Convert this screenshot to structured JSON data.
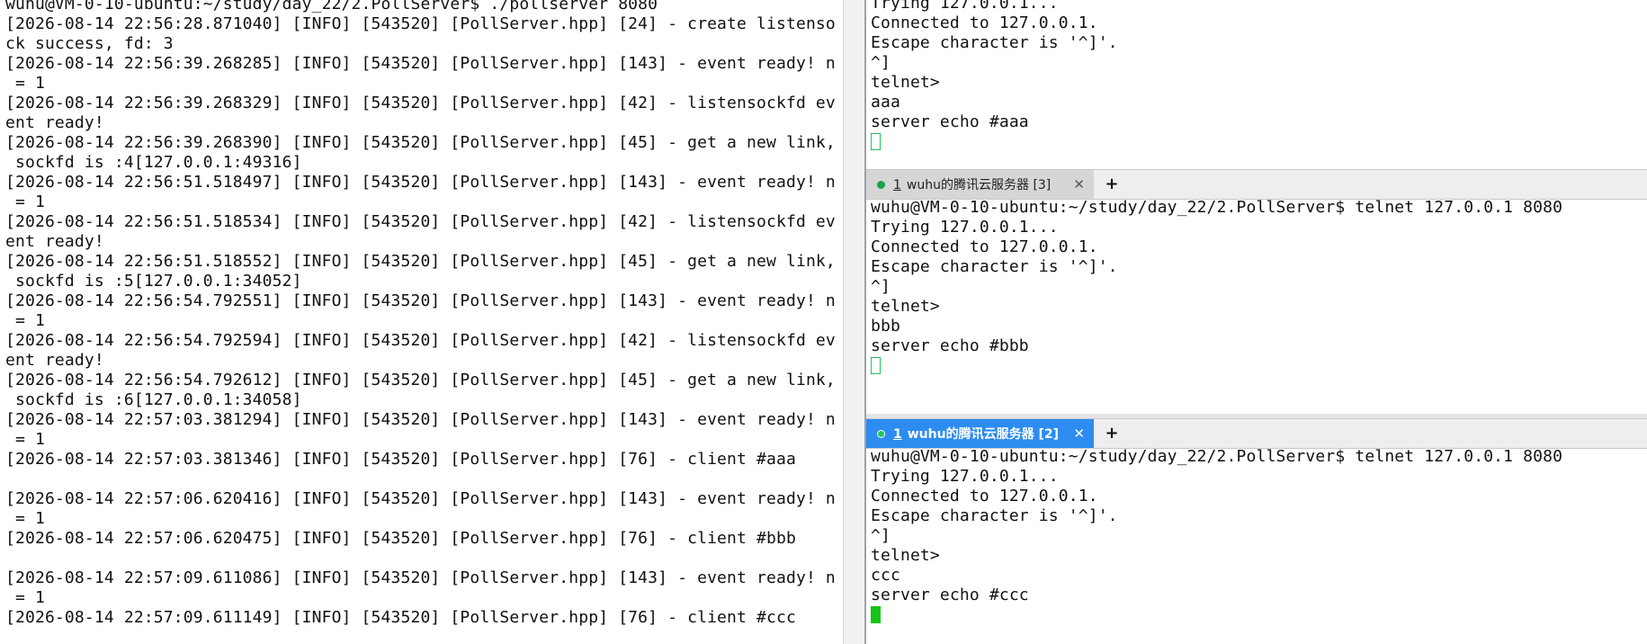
{
  "left_terminal": {
    "lines": [
      "wuhu@VM-0-10-ubuntu:~/study/day_22/2.PollServer$ ./pollserver 8080",
      "[2026-08-14 22:56:28.871040] [INFO] [543520] [PollServer.hpp] [24] - create listenso",
      "ck success, fd: 3",
      "[2026-08-14 22:56:39.268285] [INFO] [543520] [PollServer.hpp] [143] - event ready! n",
      " = 1",
      "[2026-08-14 22:56:39.268329] [INFO] [543520] [PollServer.hpp] [42] - listensockfd ev",
      "ent ready!",
      "[2026-08-14 22:56:39.268390] [INFO] [543520] [PollServer.hpp] [45] - get a new link,",
      " sockfd is :4[127.0.0.1:49316]",
      "[2026-08-14 22:56:51.518497] [INFO] [543520] [PollServer.hpp] [143] - event ready! n",
      " = 1",
      "[2026-08-14 22:56:51.518534] [INFO] [543520] [PollServer.hpp] [42] - listensockfd ev",
      "ent ready!",
      "[2026-08-14 22:56:51.518552] [INFO] [543520] [PollServer.hpp] [45] - get a new link,",
      " sockfd is :5[127.0.0.1:34052]",
      "[2026-08-14 22:56:54.792551] [INFO] [543520] [PollServer.hpp] [143] - event ready! n",
      " = 1",
      "[2026-08-14 22:56:54.792594] [INFO] [543520] [PollServer.hpp] [42] - listensockfd ev",
      "ent ready!",
      "[2026-08-14 22:56:54.792612] [INFO] [543520] [PollServer.hpp] [45] - get a new link,",
      " sockfd is :6[127.0.0.1:34058]",
      "[2026-08-14 22:57:03.381294] [INFO] [543520] [PollServer.hpp] [143] - event ready! n",
      " = 1",
      "[2026-08-14 22:57:03.381346] [INFO] [543520] [PollServer.hpp] [76] - client #aaa",
      "",
      "[2026-08-14 22:57:06.620416] [INFO] [543520] [PollServer.hpp] [143] - event ready! n",
      " = 1",
      "[2026-08-14 22:57:06.620475] [INFO] [543520] [PollServer.hpp] [76] - client #bbb",
      "",
      "[2026-08-14 22:57:09.611086] [INFO] [543520] [PollServer.hpp] [143] - event ready! n",
      " = 1",
      "[2026-08-14 22:57:09.611149] [INFO] [543520] [PollServer.hpp] [76] - client #ccc"
    ]
  },
  "top_terminal": {
    "lines": [
      "Trying 127.0.0.1...",
      "Connected to 127.0.0.1.",
      "Escape character is '^]'.",
      "^]",
      "telnet>",
      "aaa",
      "server echo #aaa"
    ],
    "cursor": "hollow"
  },
  "mid_tab": {
    "index": "1",
    "label": "wuhu的腾讯云服务器 [3]",
    "close": "✕",
    "add": "+",
    "status_color": "#16a34a"
  },
  "mid_terminal": {
    "lines": [
      "wuhu@VM-0-10-ubuntu:~/study/day_22/2.PollServer$ telnet 127.0.0.1 8080",
      "Trying 127.0.0.1...",
      "Connected to 127.0.0.1.",
      "Escape character is '^]'.",
      "^]",
      "telnet>",
      "bbb",
      "server echo #bbb"
    ],
    "cursor": "hollow"
  },
  "bot_tab": {
    "index": "1",
    "label": "wuhu的腾讯云服务器 [2]",
    "close": "✕",
    "add": "+",
    "active_color": "#2d8cf0"
  },
  "bot_terminal": {
    "lines": [
      "wuhu@VM-0-10-ubuntu:~/study/day_22/2.PollServer$ telnet 127.0.0.1 8080",
      "Trying 127.0.0.1...",
      "Connected to 127.0.0.1.",
      "Escape character is '^]'.",
      "^]",
      "telnet>",
      "ccc",
      "server echo #ccc"
    ],
    "cursor": "solid"
  }
}
